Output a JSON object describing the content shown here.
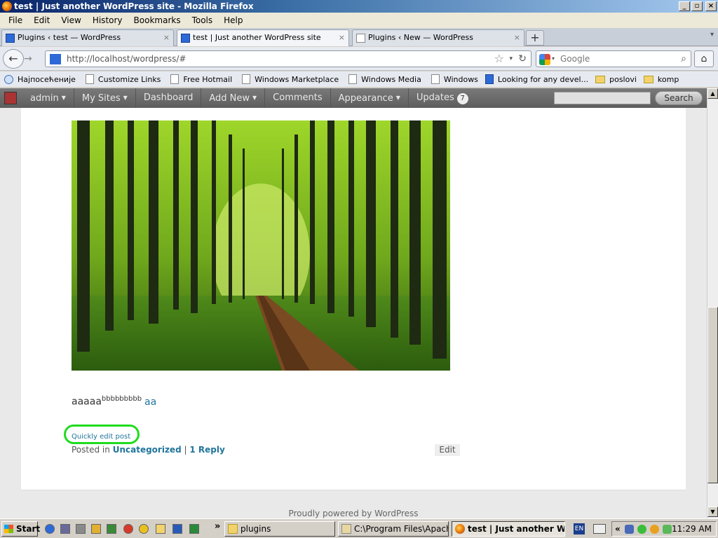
{
  "window": {
    "title": "test | Just another WordPress site - Mozilla Firefox",
    "btn_min": "_",
    "btn_max": "▫",
    "btn_close": "×"
  },
  "menu": [
    "File",
    "Edit",
    "View",
    "History",
    "Bookmarks",
    "Tools",
    "Help"
  ],
  "tabs": [
    {
      "label": "Plugins ‹ test — WordPress"
    },
    {
      "label": "test | Just another WordPress site"
    },
    {
      "label": "Plugins ‹ New — WordPress"
    }
  ],
  "tab_close": "×",
  "new_tab": "+",
  "tab_list": "▾",
  "nav": {
    "url": "http://localhost/wordpress/#",
    "search_placeholder": "Google",
    "back": "←",
    "forward": "→",
    "reload": "↻",
    "star": "☆",
    "dropdown": "▾",
    "search_go": "⌕",
    "home": "⌂"
  },
  "bookmarks": [
    {
      "label": "Најпосећеније",
      "icon": "search"
    },
    {
      "label": "Customize Links",
      "icon": "page"
    },
    {
      "label": "Free Hotmail",
      "icon": "page"
    },
    {
      "label": "Windows Marketplace",
      "icon": "page"
    },
    {
      "label": "Windows Media",
      "icon": "page"
    },
    {
      "label": "Windows",
      "icon": "page"
    },
    {
      "label": "Looking for any devel...",
      "icon": "y"
    },
    {
      "label": "poslovi",
      "icon": "folder"
    },
    {
      "label": "komp",
      "icon": "folder"
    }
  ],
  "adminbar": {
    "items": [
      {
        "label": "admin",
        "caret": true
      },
      {
        "label": "My Sites",
        "caret": true
      },
      {
        "label": "Dashboard",
        "caret": false
      },
      {
        "label": "Add New",
        "caret": true
      },
      {
        "label": "Comments",
        "caret": false
      },
      {
        "label": "Appearance",
        "caret": true
      },
      {
        "label": "Updates",
        "caret": false
      }
    ],
    "caret_glyph": "▼",
    "updates_count": "7",
    "search_label": "Search"
  },
  "post": {
    "text_main": "aaaaa",
    "text_sup": "bbbbbbbbb",
    "link_text": "aa",
    "quick_edit": "Quickly edit post",
    "posted_in": "Posted in",
    "category": "Uncategorized",
    "separator": "|",
    "reply": "1 Reply",
    "edit": "Edit"
  },
  "footer": "Proudly powered by WordPress",
  "scrollbar": {
    "up": "▲",
    "down": "▼"
  },
  "taskbar": {
    "start": "Start",
    "more": "»",
    "buttons": [
      {
        "label": "plugins"
      },
      {
        "label": "C:\\Program Files\\Apache..."
      },
      {
        "label": "test | Just another W..."
      }
    ],
    "lang": "EN",
    "tray_chevron": "«",
    "clock": "11:29 AM"
  }
}
